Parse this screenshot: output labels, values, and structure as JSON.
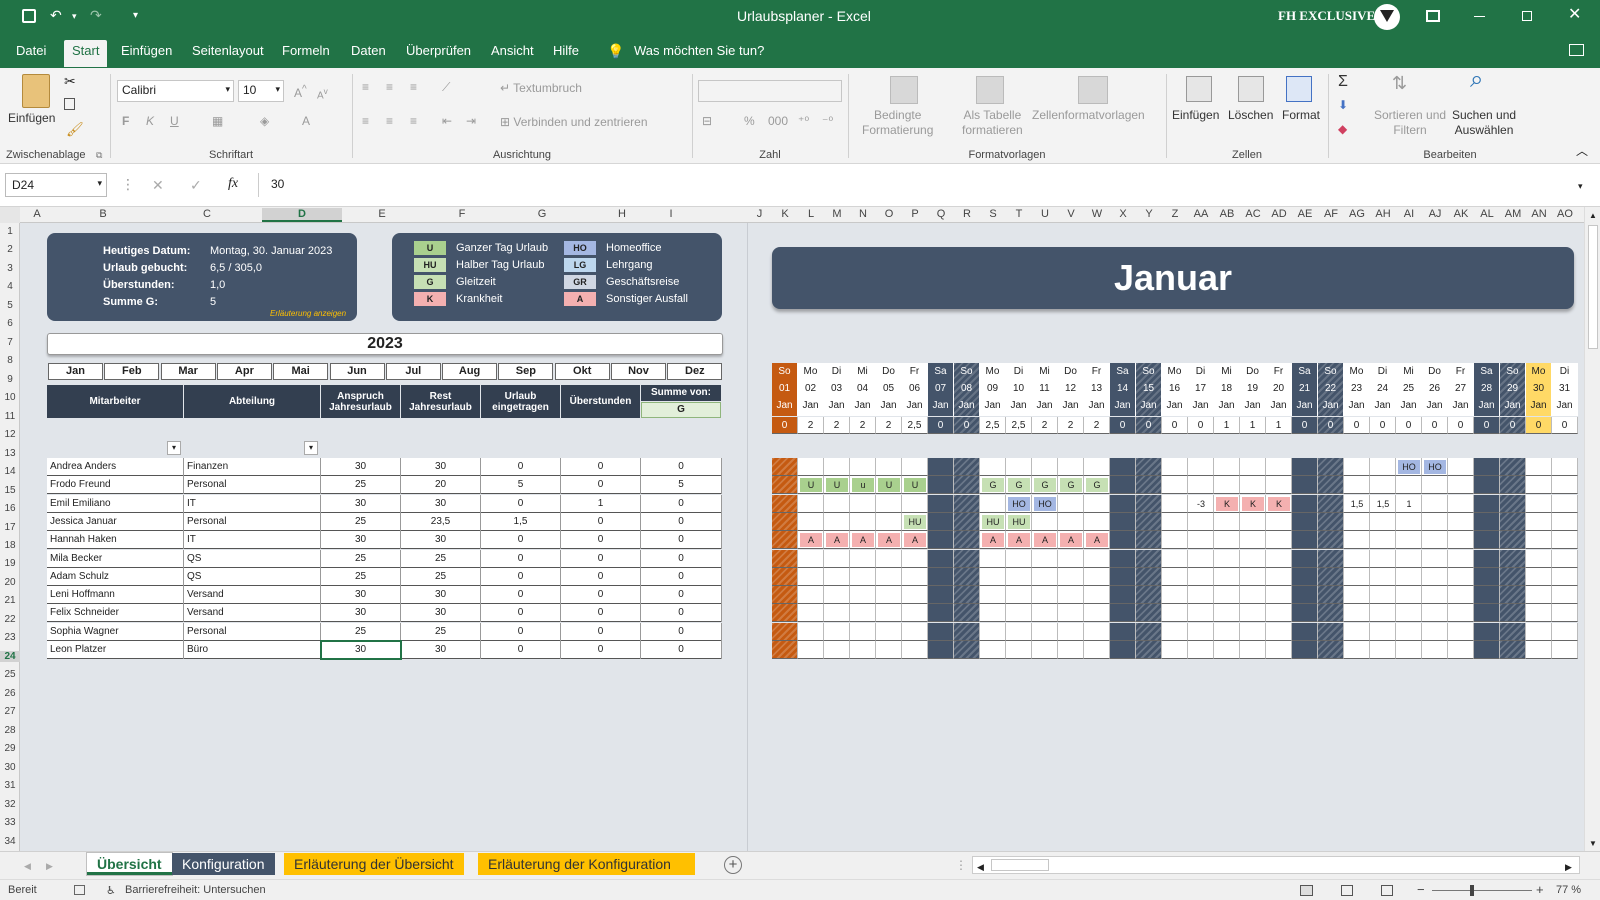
{
  "window": {
    "title": "Urlaubsplaner - Excel",
    "account": "FH EXCLUSIVE"
  },
  "menu": {
    "tabs": [
      "Datei",
      "Start",
      "Einfügen",
      "Seitenlayout",
      "Formeln",
      "Daten",
      "Überprüfen",
      "Ansicht",
      "Hilfe"
    ],
    "tellme": "Was möchten Sie tun?"
  },
  "ribbon": {
    "paste": "Einfügen",
    "clipboard": "Zwischenablage",
    "font": "Calibri",
    "size": "10",
    "font_group": "Schriftart",
    "wrap": "Textumbruch",
    "merge": "Verbinden und zentrieren",
    "align_group": "Ausrichtung",
    "number_group": "Zahl",
    "cond": [
      "Bedingte",
      "Formatierung"
    ],
    "astable": [
      "Als Tabelle",
      "formatieren"
    ],
    "cellstyles": "Zellenformatvorlagen",
    "styles_group": "Formatvorlagen",
    "insert": "Einfügen",
    "delete": "Löschen",
    "format": "Format",
    "cells_group": "Zellen",
    "sort": [
      "Sortieren und",
      "Filtern"
    ],
    "find": [
      "Suchen und",
      "Auswählen"
    ],
    "edit_group": "Bearbeiten"
  },
  "formula": {
    "namebox": "D24",
    "value": "30"
  },
  "columns_left": [
    "A",
    "B",
    "C",
    "D",
    "E",
    "F",
    "G",
    "H",
    "I"
  ],
  "columns_right": [
    "J",
    "K",
    "L",
    "M",
    "N",
    "O",
    "P",
    "Q",
    "R",
    "S",
    "T",
    "U",
    "V",
    "W",
    "X",
    "Y",
    "Z",
    "AA",
    "AB",
    "AC",
    "AD",
    "AE",
    "AF",
    "AG",
    "AH",
    "AI",
    "AJ",
    "AK",
    "AL",
    "AM",
    "AN",
    "AO"
  ],
  "rows": [
    "1",
    "2",
    "3",
    "4",
    "5",
    "6",
    "7",
    "8",
    "9",
    "10",
    "11",
    "12",
    "13",
    "14",
    "15",
    "16",
    "17",
    "18",
    "19",
    "20",
    "21",
    "22",
    "23",
    "24",
    "25",
    "26",
    "27",
    "28",
    "29",
    "30",
    "31",
    "32",
    "33",
    "34"
  ],
  "info": {
    "labels": [
      "Heutiges Datum:",
      "Urlaub gebucht:",
      "Überstunden:",
      "Summe G:"
    ],
    "values": [
      "Montag, 30. Januar 2023",
      "6,5 / 305,0",
      "1,0",
      "5"
    ],
    "link": "Erläuterung anzeigen"
  },
  "legend": [
    {
      "code": "U",
      "text": "Ganzer Tag Urlaub",
      "color": "#a9d08e"
    },
    {
      "code": "HU",
      "text": "Halber Tag Urlaub",
      "color": "#c6e0b4"
    },
    {
      "code": "G",
      "text": "Gleitzeit",
      "color": "#c6e0b4"
    },
    {
      "code": "K",
      "text": "Krankheit",
      "color": "#f4b0b0"
    },
    {
      "code": "HO",
      "text": "Homeoffice",
      "color": "#a4b7e2"
    },
    {
      "code": "LG",
      "text": "Lehrgang",
      "color": "#bdd7ee"
    },
    {
      "code": "GR",
      "text": "Geschäftsreise",
      "color": "#d0d7e3"
    },
    {
      "code": "A",
      "text": "Sonstiger Ausfall",
      "color": "#f4b0b0"
    }
  ],
  "year": "2023",
  "months": [
    "Jan",
    "Feb",
    "Mar",
    "Apr",
    "Mai",
    "Jun",
    "Jul",
    "Aug",
    "Sep",
    "Okt",
    "Nov",
    "Dez"
  ],
  "table_headers": [
    "Mitarbeiter",
    "Abteilung",
    "Anspruch Jahresurlaub",
    "Rest Jahresurlaub",
    "Urlaub eingetragen",
    "Überstunden",
    "Summe von:"
  ],
  "sum_key": "G",
  "employees": [
    {
      "name": "Andrea Anders",
      "dept": "Finanzen",
      "claim": "30",
      "rest": "30",
      "booked": "0",
      "ot": "0",
      "sum": "0"
    },
    {
      "name": "Frodo Freund",
      "dept": "Personal",
      "claim": "25",
      "rest": "20",
      "booked": "5",
      "ot": "0",
      "sum": "5"
    },
    {
      "name": "Emil Emiliano",
      "dept": "IT",
      "claim": "30",
      "rest": "30",
      "booked": "0",
      "ot": "1",
      "sum": "0"
    },
    {
      "name": "Jessica Januar",
      "dept": "Personal",
      "claim": "25",
      "rest": "23,5",
      "booked": "1,5",
      "ot": "0",
      "sum": "0"
    },
    {
      "name": "Hannah Haken",
      "dept": "IT",
      "claim": "30",
      "rest": "30",
      "booked": "0",
      "ot": "0",
      "sum": "0"
    },
    {
      "name": "Mila Becker",
      "dept": "QS",
      "claim": "25",
      "rest": "25",
      "booked": "0",
      "ot": "0",
      "sum": "0"
    },
    {
      "name": "Adam Schulz",
      "dept": "QS",
      "claim": "25",
      "rest": "25",
      "booked": "0",
      "ot": "0",
      "sum": "0"
    },
    {
      "name": "Leni Hoffmann",
      "dept": "Versand",
      "claim": "30",
      "rest": "30",
      "booked": "0",
      "ot": "0",
      "sum": "0"
    },
    {
      "name": "Felix Schneider",
      "dept": "Versand",
      "claim": "30",
      "rest": "30",
      "booked": "0",
      "ot": "0",
      "sum": "0"
    },
    {
      "name": "Sophia Wagner",
      "dept": "Personal",
      "claim": "25",
      "rest": "25",
      "booked": "0",
      "ot": "0",
      "sum": "0"
    },
    {
      "name": "Leon Platzer",
      "dept": "Büro",
      "claim": "30",
      "rest": "30",
      "booked": "0",
      "ot": "0",
      "sum": "0"
    }
  ],
  "calendar": {
    "month": "Januar",
    "weekdays": [
      "So",
      "Mo",
      "Di",
      "Mi",
      "Do",
      "Fr",
      "Sa",
      "So",
      "Mo",
      "Di",
      "Mi",
      "Do",
      "Fr",
      "Sa",
      "So",
      "Mo",
      "Di",
      "Mi",
      "Do",
      "Fr",
      "Sa",
      "So",
      "Mo",
      "Di",
      "Mi",
      "Do",
      "Fr",
      "Sa",
      "So",
      "Mo",
      "Di"
    ],
    "days": [
      "01",
      "02",
      "03",
      "04",
      "05",
      "06",
      "07",
      "08",
      "09",
      "10",
      "11",
      "12",
      "13",
      "14",
      "15",
      "16",
      "17",
      "18",
      "19",
      "20",
      "21",
      "22",
      "23",
      "24",
      "25",
      "26",
      "27",
      "28",
      "29",
      "30",
      "31"
    ],
    "mon": "Jan",
    "totals": [
      "0",
      "2",
      "2",
      "2",
      "2",
      "2,5",
      "0",
      "0",
      "2,5",
      "2,5",
      "2",
      "2",
      "2",
      "0",
      "0",
      "0",
      "0",
      "1",
      "1",
      "1",
      "0",
      "0",
      "0",
      "0",
      "0",
      "0",
      "0",
      "0",
      "0",
      "0",
      "0"
    ],
    "entries": [
      {
        "row": 0,
        "day": 24,
        "code": "HO"
      },
      {
        "row": 0,
        "day": 25,
        "code": "HO"
      },
      {
        "row": 1,
        "day": 1,
        "code": "U"
      },
      {
        "row": 1,
        "day": 2,
        "code": "U"
      },
      {
        "row": 1,
        "day": 3,
        "code": "u"
      },
      {
        "row": 1,
        "day": 4,
        "code": "U"
      },
      {
        "row": 1,
        "day": 5,
        "code": "U"
      },
      {
        "row": 1,
        "day": 8,
        "code": "G"
      },
      {
        "row": 1,
        "day": 9,
        "code": "G"
      },
      {
        "row": 1,
        "day": 10,
        "code": "G"
      },
      {
        "row": 1,
        "day": 11,
        "code": "G"
      },
      {
        "row": 1,
        "day": 12,
        "code": "G"
      },
      {
        "row": 2,
        "day": 9,
        "code": "HO"
      },
      {
        "row": 2,
        "day": 10,
        "code": "HO"
      },
      {
        "row": 2,
        "day": 16,
        "code": "-3"
      },
      {
        "row": 2,
        "day": 17,
        "code": "K"
      },
      {
        "row": 2,
        "day": 18,
        "code": "K"
      },
      {
        "row": 2,
        "day": 19,
        "code": "K"
      },
      {
        "row": 2,
        "day": 22,
        "code": "1,5"
      },
      {
        "row": 2,
        "day": 23,
        "code": "1,5"
      },
      {
        "row": 2,
        "day": 24,
        "code": "1"
      },
      {
        "row": 3,
        "day": 5,
        "code": "HU"
      },
      {
        "row": 3,
        "day": 8,
        "code": "HU"
      },
      {
        "row": 3,
        "day": 9,
        "code": "HU"
      },
      {
        "row": 4,
        "day": 1,
        "code": "A"
      },
      {
        "row": 4,
        "day": 2,
        "code": "A"
      },
      {
        "row": 4,
        "day": 3,
        "code": "A"
      },
      {
        "row": 4,
        "day": 4,
        "code": "A"
      },
      {
        "row": 4,
        "day": 5,
        "code": "A"
      },
      {
        "row": 4,
        "day": 8,
        "code": "A"
      },
      {
        "row": 4,
        "day": 9,
        "code": "A"
      },
      {
        "row": 4,
        "day": 10,
        "code": "A"
      },
      {
        "row": 4,
        "day": 11,
        "code": "A"
      },
      {
        "row": 4,
        "day": 12,
        "code": "A"
      }
    ]
  },
  "sheets": [
    "Übersicht",
    "Konfiguration",
    "Erläuterung der Übersicht",
    "Erläuterung der Konfiguration"
  ],
  "status": {
    "ready": "Bereit",
    "access": "Barrierefreiheit: Untersuchen",
    "zoom": "77 %"
  },
  "colors": {
    "excel_green": "#217346",
    "panel": "#44546a",
    "header_dark": "#333f50",
    "weekend": "#44546a",
    "holiday": "#c55a11",
    "today": "#ffd966",
    "tab_gold": "#ffc000"
  }
}
